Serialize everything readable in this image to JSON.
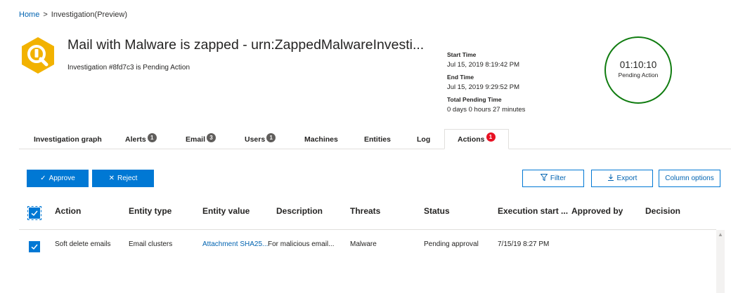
{
  "breadcrumb": {
    "home": "Home",
    "separator": ">",
    "current": "Investigation(Preview)"
  },
  "header": {
    "title": "Mail with Malware is zapped - urn:ZappedMalwareInvesti...",
    "subtitle": "Investigation #8fd7c3 is Pending Action",
    "logo_icon": "investigation-icon",
    "logo_color": "#f2b200"
  },
  "meta": {
    "start_label": "Start Time",
    "start_value": "Jul 15, 2019 8:19:42 PM",
    "end_label": "End Time",
    "end_value": "Jul 15, 2019 9:29:52 PM",
    "pending_label": "Total Pending Time",
    "pending_value": "0 days 0 hours 27 minutes"
  },
  "timer": {
    "time": "01:10:10",
    "status": "Pending Action",
    "ring_color": "#107c10"
  },
  "tabs": [
    {
      "label": "Investigation graph",
      "badge": ""
    },
    {
      "label": "Alerts",
      "badge": "1"
    },
    {
      "label": "Email",
      "badge": "3"
    },
    {
      "label": "Users",
      "badge": "1"
    },
    {
      "label": "Machines",
      "badge": ""
    },
    {
      "label": "Entities",
      "badge": ""
    },
    {
      "label": "Log",
      "badge": ""
    },
    {
      "label": "Actions",
      "badge": "1",
      "active": true
    }
  ],
  "toolbar": {
    "approve": "Approve",
    "reject": "Reject",
    "filter": "Filter",
    "export": "Export",
    "column_options": "Column options"
  },
  "table": {
    "headers": [
      "Action",
      "Entity type",
      "Entity value",
      "Description",
      "Threats",
      "Status",
      "Execution start ...",
      "Approved by",
      "Decision"
    ],
    "rows": [
      {
        "checked": true,
        "action": "Soft delete emails",
        "entity_type": "Email clusters",
        "entity_value": "Attachment SHA25...",
        "description": "For malicious email...",
        "threats": "Malware",
        "status": "Pending approval",
        "execution_start": "7/15/19 8:27 PM",
        "approved_by": "",
        "decision": ""
      }
    ]
  },
  "colors": {
    "accent": "#0078d4",
    "danger_badge": "#e81123",
    "neutral_badge": "#605e5c"
  }
}
